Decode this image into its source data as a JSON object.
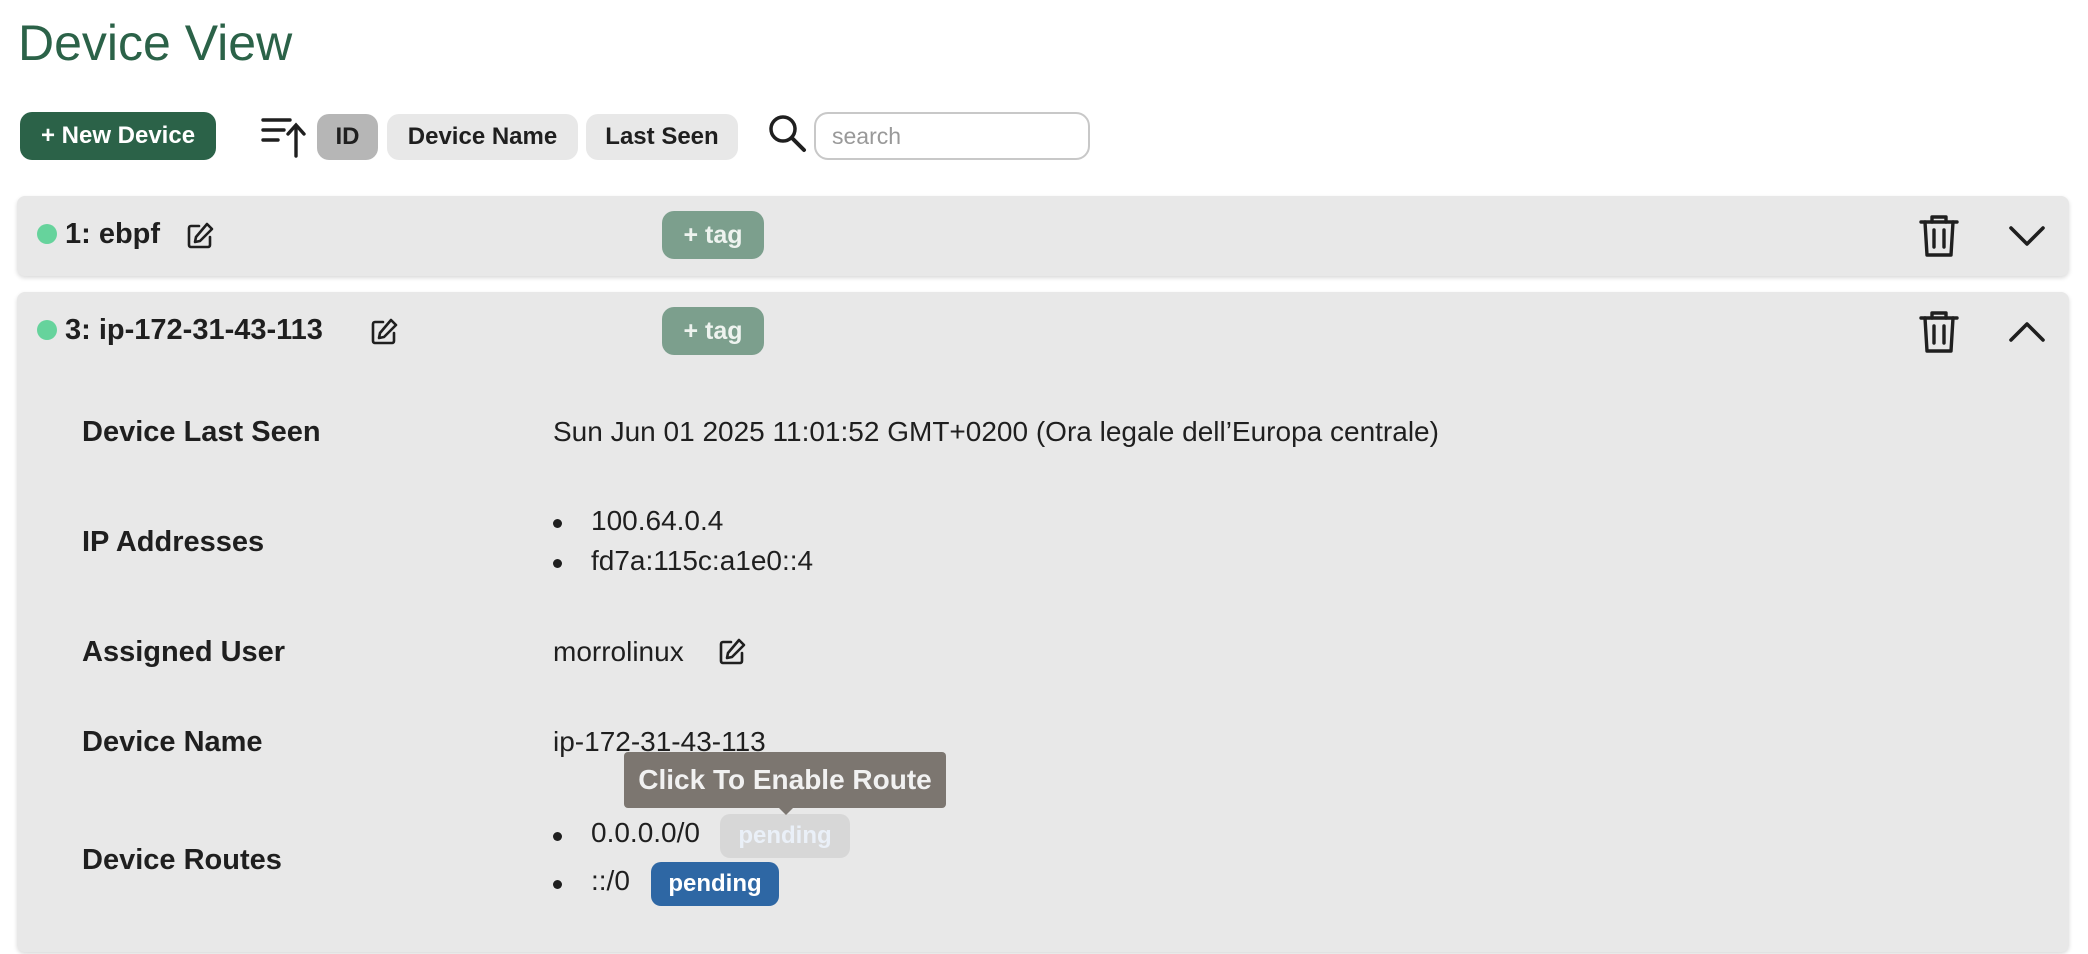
{
  "page": {
    "title": "Device View"
  },
  "toolbar": {
    "new_device_label": "+ New Device",
    "sort_options": [
      "ID",
      "Device Name",
      "Last Seen"
    ],
    "active_sort": "ID",
    "search": {
      "placeholder": "search",
      "value": ""
    }
  },
  "devices": [
    {
      "title": "1: ebpf",
      "online": true,
      "tag_label": "+ tag",
      "expanded": false
    },
    {
      "title": "3: ip-172-31-43-113",
      "online": true,
      "tag_label": "+ tag",
      "expanded": true,
      "details": {
        "last_seen_label": "Device Last Seen",
        "last_seen": "Sun Jun 01 2025 11:01:52 GMT+0200 (Ora legale dell’Europa centrale)",
        "ip_label": "IP Addresses",
        "ip_addresses": [
          "100.64.0.4",
          "fd7a:115c:a1e0::4"
        ],
        "user_label": "Assigned User",
        "user": "morrolinux",
        "name_label": "Device Name",
        "name": "ip-172-31-43-113",
        "routes_label": "Device Routes",
        "routes": [
          {
            "route": "0.0.0.0/0",
            "status": "pending"
          },
          {
            "route": "::/0",
            "status": "pending"
          }
        ]
      }
    }
  ],
  "tooltip": "Click To Enable Route",
  "colors": {
    "brand": "#2b6248",
    "online": "#66d39c",
    "tag": "#7c9f8d",
    "pending": "#2e67a4"
  }
}
